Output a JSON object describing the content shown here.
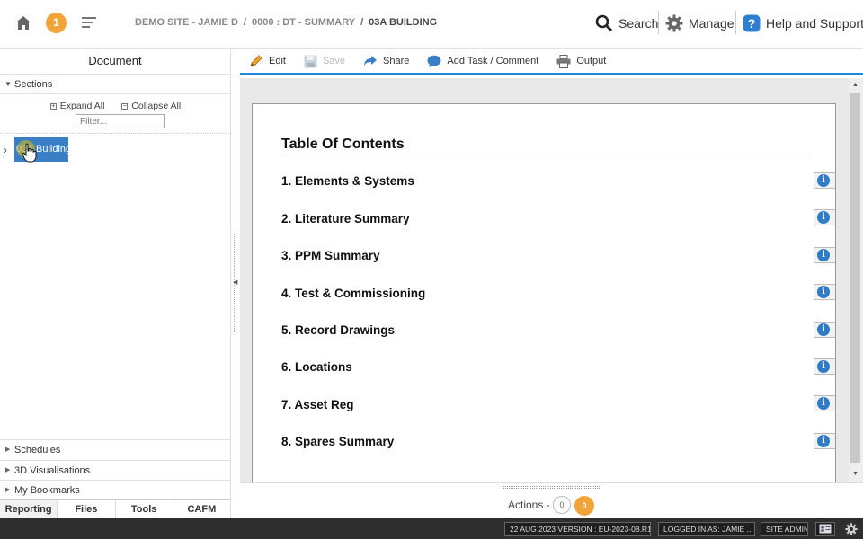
{
  "header": {
    "notification_count": "1",
    "breadcrumb": [
      "DEMO SITE - JAMIE D",
      "0000 : DT - SUMMARY",
      "03A BUILDING"
    ],
    "breadcrumb_sep": "/",
    "search_label": "Search",
    "manage_label": "Manage",
    "help_label": "Help and Support"
  },
  "left_panel": {
    "title": "Document",
    "sections_label": "Sections",
    "expand_all": "Expand All",
    "collapse_all": "Collapse All",
    "filter_placeholder": "Filter...",
    "tree_item": "03A Building",
    "schedules": "Schedules",
    "visualisations": "3D Visualisations",
    "bookmarks": "My Bookmarks",
    "tabs": [
      "Reporting",
      "Files",
      "Tools",
      "CAFM"
    ],
    "active_tab": "Reporting"
  },
  "toolbar": {
    "edit": "Edit",
    "save": "Save",
    "share": "Share",
    "add_task": "Add Task / Comment",
    "output": "Output"
  },
  "document": {
    "toc_title": "Table Of Contents",
    "items": [
      "1. Elements & Systems",
      "2. Literature Summary",
      "3. PPM Summary",
      "4. Test & Commissioning",
      "5. Record Drawings",
      "6. Locations",
      "7. Asset Reg",
      "8. Spares Summary"
    ]
  },
  "actions": {
    "label": "Actions -",
    "count_a": "0",
    "count_b": "0"
  },
  "status_bar": {
    "version": "22 AUG 2023 VERSION : EU-2023-08.R1",
    "logged_in": "LOGGED IN AS: JAMIE ...",
    "role": "SITE ADMIN"
  },
  "colors": {
    "accent": "#1f87d8",
    "notif": "#f2a33a",
    "selected": "#3a7fc6"
  }
}
